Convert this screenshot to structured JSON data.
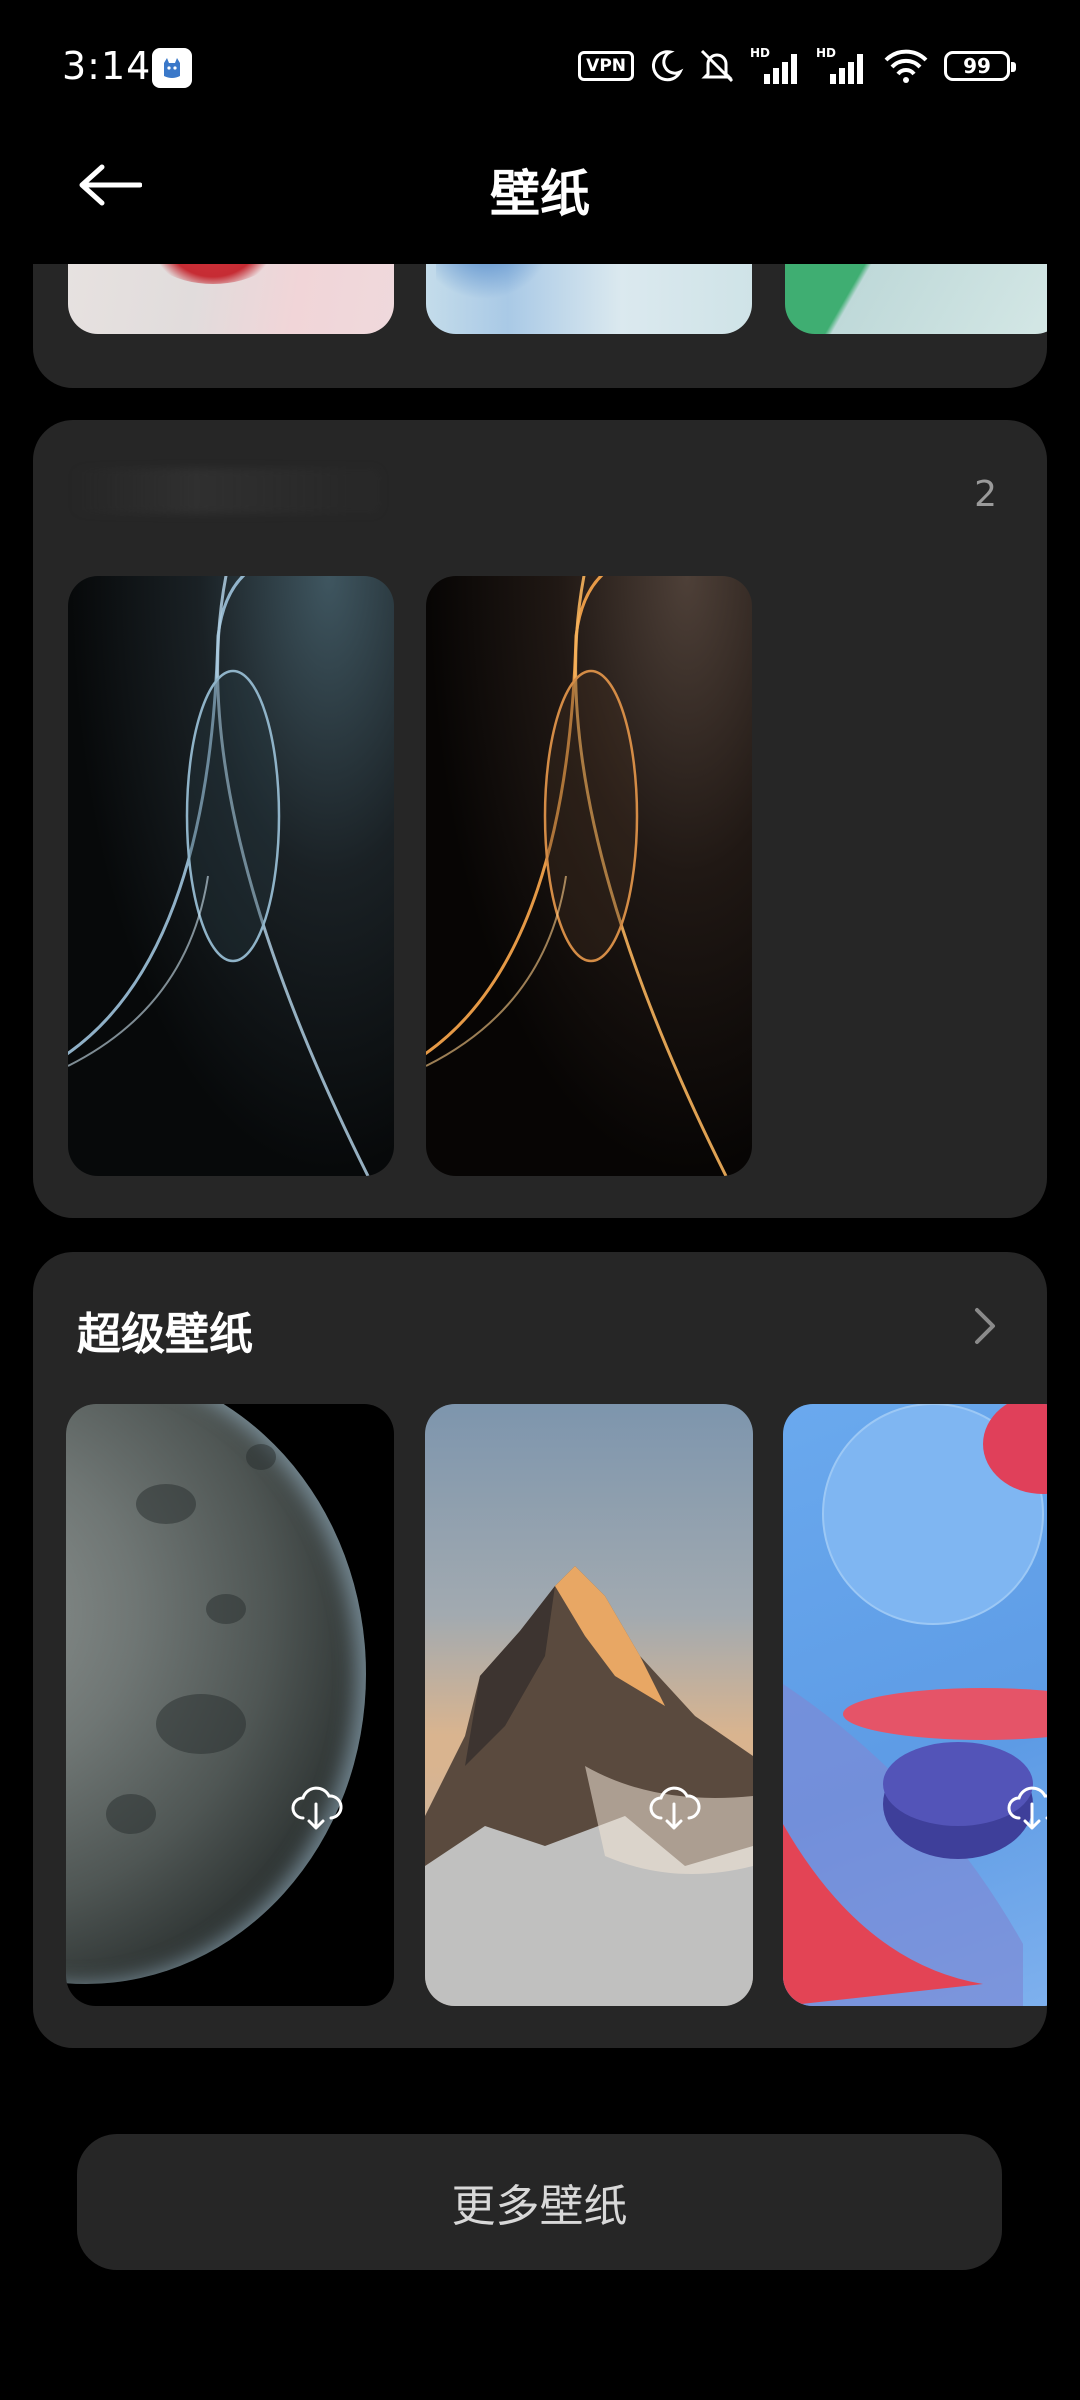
{
  "status_bar": {
    "time": "3:14",
    "vpn_label": "VPN",
    "battery": "99",
    "icons": [
      "app-notification-icon",
      "moon-icon",
      "bell-muted-icon",
      "signal-hd-icon",
      "signal-hd-icon",
      "wifi-icon",
      "battery-icon"
    ]
  },
  "header": {
    "title": "壁纸",
    "back_icon": "back-arrow-icon"
  },
  "section_mid": {
    "count": "2"
  },
  "section_super": {
    "title": "超级壁纸",
    "chevron_icon": "chevron-right-icon",
    "download_icon": "cloud-download-icon"
  },
  "footer": {
    "more_button_label": "更多壁纸"
  },
  "colors": {
    "background": "#000000",
    "card": "#262626",
    "text": "#ffffff",
    "muted": "#9a9a9a"
  }
}
